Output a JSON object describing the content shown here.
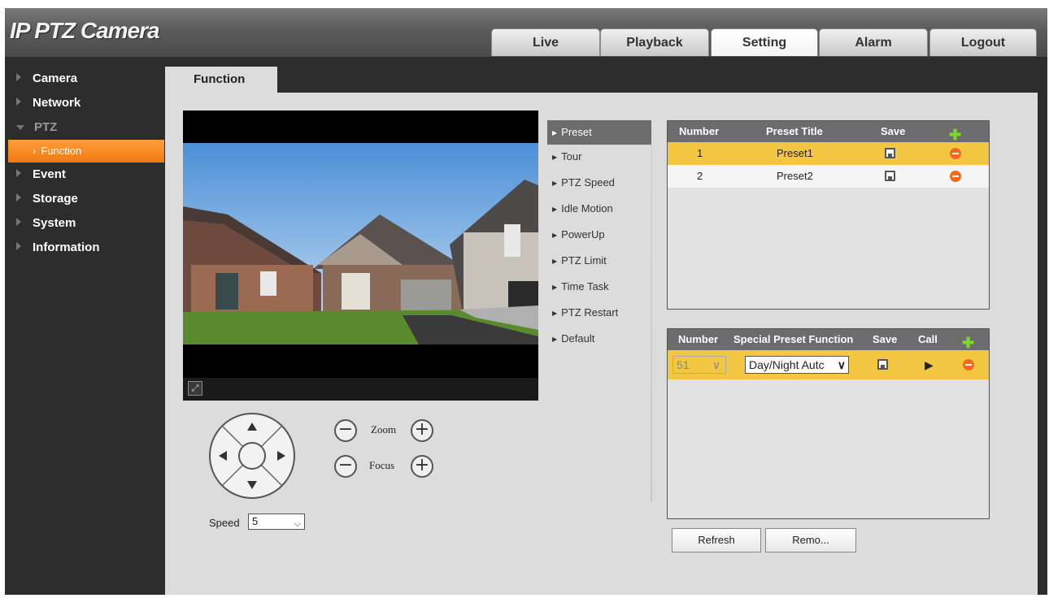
{
  "app": {
    "title": "IP PTZ Camera"
  },
  "nav": {
    "tabs": [
      {
        "label": "Live"
      },
      {
        "label": "Playback"
      },
      {
        "label": "Setting"
      },
      {
        "label": "Alarm"
      },
      {
        "label": "Logout"
      }
    ],
    "active": "Setting"
  },
  "sidebar": {
    "items": [
      {
        "label": "Camera"
      },
      {
        "label": "Network"
      },
      {
        "label": "PTZ"
      },
      {
        "label": "Event"
      },
      {
        "label": "Storage"
      },
      {
        "label": "System"
      },
      {
        "label": "Information"
      }
    ],
    "sub_item": "Function"
  },
  "content": {
    "tab_label": "Function"
  },
  "ptz": {
    "zoom_label": "Zoom",
    "focus_label": "Focus",
    "speed_label": "Speed",
    "speed_value": "5"
  },
  "menu": {
    "items": [
      {
        "label": "Preset"
      },
      {
        "label": "Tour"
      },
      {
        "label": "PTZ Speed"
      },
      {
        "label": "Idle Motion"
      },
      {
        "label": "PowerUp"
      },
      {
        "label": "PTZ Limit"
      },
      {
        "label": "Time Task"
      },
      {
        "label": "PTZ Restart"
      },
      {
        "label": "Default"
      }
    ],
    "active": "Preset"
  },
  "preset_table": {
    "headers": {
      "number": "Number",
      "title": "Preset Title",
      "save": "Save"
    },
    "rows": [
      {
        "number": "1",
        "title": "Preset1"
      },
      {
        "number": "2",
        "title": "Preset2"
      }
    ]
  },
  "special_table": {
    "headers": {
      "number": "Number",
      "function": "Special Preset Function",
      "save": "Save",
      "call": "Call"
    },
    "rows": [
      {
        "number": "51",
        "function": "Day/Night Autc"
      }
    ]
  },
  "buttons": {
    "refresh": "Refresh",
    "remove": "Remo..."
  },
  "colors": {
    "accent": "#f07a12",
    "selected_row": "#f4c743",
    "header": "#6c6c6c"
  },
  "icons": [
    "save-icon",
    "delete-icon",
    "add-icon",
    "play-icon",
    "fullscreen-icon"
  ]
}
